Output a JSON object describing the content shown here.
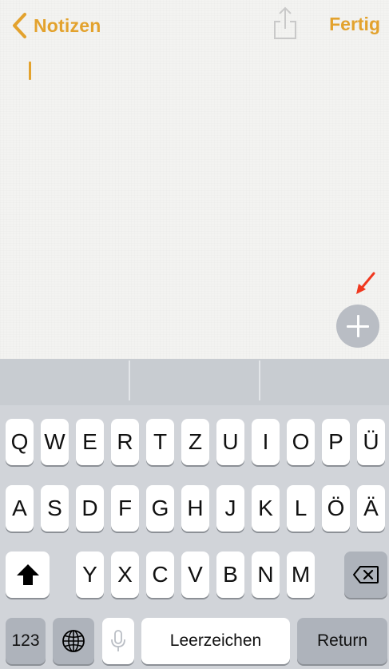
{
  "nav": {
    "back_label": "Notizen",
    "done_label": "Fertig"
  },
  "note": {
    "text": ""
  },
  "icons": {
    "back": "chevron-left-icon",
    "share": "share-icon",
    "add": "plus-icon",
    "annotation": "red-arrow-icon",
    "shift": "shift-icon",
    "delete": "backspace-icon",
    "globe": "globe-icon",
    "mic": "microphone-icon"
  },
  "colors": {
    "accent": "#e3a22d",
    "annotation_arrow": "#f0381f",
    "add_button": "#b9bdc4",
    "keyboard_bg": "#d1d4d9",
    "suggestion_bar": "#c8ccd1"
  },
  "keyboard": {
    "row1": [
      "Q",
      "W",
      "E",
      "R",
      "T",
      "Z",
      "U",
      "I",
      "O",
      "P",
      "Ü"
    ],
    "row2": [
      "A",
      "S",
      "D",
      "F",
      "G",
      "H",
      "J",
      "K",
      "L",
      "Ö",
      "Ä"
    ],
    "row3": [
      "Y",
      "X",
      "C",
      "V",
      "B",
      "N",
      "M"
    ],
    "numbers_label": "123",
    "space_label": "Leerzeichen",
    "return_label": "Return"
  }
}
